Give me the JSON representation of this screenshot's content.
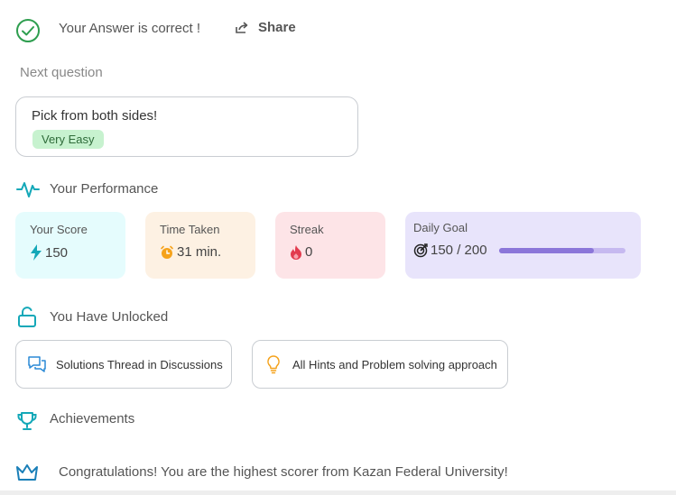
{
  "header": {
    "answer_status": "Your Answer is correct !",
    "share_label": "Share"
  },
  "next_question": {
    "label": "Next question",
    "title": "Pick from both sides!",
    "difficulty": "Very Easy"
  },
  "performance": {
    "title": "Your Performance",
    "score": {
      "label": "Your Score",
      "value": "150"
    },
    "time": {
      "label": "Time Taken",
      "value": "31 min."
    },
    "streak": {
      "label": "Streak",
      "value": "0"
    },
    "daily_goal": {
      "label": "Daily Goal",
      "value": "150 / 200",
      "progress": 0.75
    }
  },
  "unlocked": {
    "title": "You Have Unlocked",
    "items": [
      {
        "label": "Solutions Thread in Discussions",
        "icon": "chat-icon"
      },
      {
        "label": "All Hints and Problem solving approach",
        "icon": "lightbulb-icon"
      }
    ]
  },
  "achievements": {
    "title": "Achievements",
    "message": "Congratulations! You are the highest scorer from Kazan Federal University!"
  },
  "colors": {
    "success": "#2e9e4f",
    "accent": "#14a8b8",
    "goal_bar": "#8b76d9",
    "badge_bg": "#c7f2cf"
  }
}
